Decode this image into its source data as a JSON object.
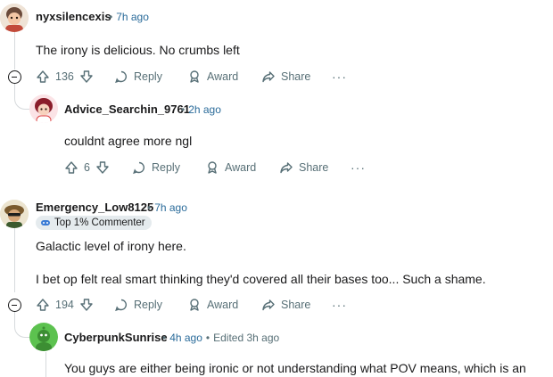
{
  "comments": [
    {
      "username": "nyxsilencexis",
      "time": "7h ago",
      "body": "The irony is delicious. No crumbs left",
      "votes": "136"
    },
    {
      "username": "Advice_Searchin_9761",
      "time": "2h ago",
      "body": "couldnt agree more ngl",
      "votes": "6"
    },
    {
      "username": "Emergency_Low8125",
      "time": "7h ago",
      "flair": "Top 1% Commenter",
      "body_lines": [
        "Galactic level of irony here.",
        "I bet op felt real smart thinking they'd covered all their bases too... Such a shame."
      ],
      "votes": "194"
    },
    {
      "username": "CyberpunkSunrise",
      "time": "4h ago",
      "edited": "Edited 3h ago",
      "body": "You guys are either being ironic or not understanding what POV means, which is an"
    }
  ],
  "actions": {
    "reply": "Reply",
    "award": "Award",
    "share": "Share",
    "more": "···"
  },
  "icons": [
    "upvote-icon",
    "downvote-icon",
    "reply-icon",
    "award-icon",
    "share-icon",
    "collapse-icon",
    "more-icon"
  ],
  "colors": {
    "meta_time": "#2a6b9a",
    "secondary_text": "#576f76",
    "flair_bg": "#e5ebee",
    "thread_line": "#d6dadc"
  }
}
